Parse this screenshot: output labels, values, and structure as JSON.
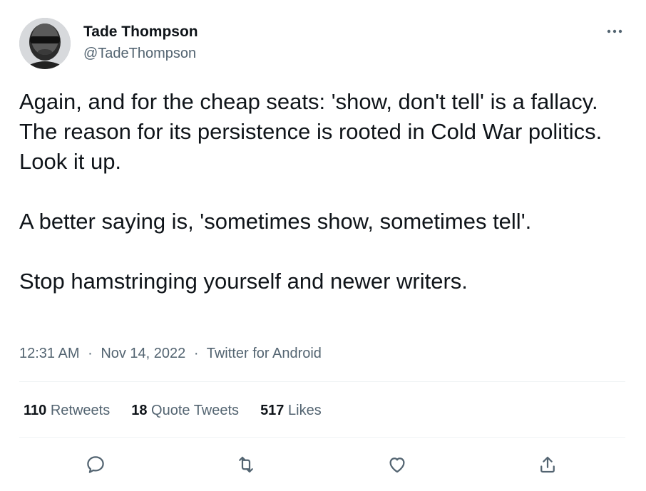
{
  "author": {
    "name": "Tade Thompson",
    "handle": "@TadeThompson"
  },
  "tweet": {
    "paragraphs": [
      "Again, and for the cheap seats: 'show, don't tell' is a fallacy.\nThe reason for its persistence is rooted in Cold War politics. Look it up.",
      "A better saying is, 'sometimes show, sometimes tell'.",
      "Stop hamstringing yourself and newer writers."
    ],
    "time": "12:31 AM",
    "date": "Nov 14, 2022",
    "source": "Twitter for Android",
    "separator": "·"
  },
  "stats": {
    "retweets": {
      "count": "110",
      "label": "Retweets"
    },
    "quotes": {
      "count": "18",
      "label": "Quote Tweets"
    },
    "likes": {
      "count": "517",
      "label": "Likes"
    }
  },
  "icons": {
    "more": "more-horizontal-icon",
    "reply": "reply-icon",
    "retweet": "retweet-icon",
    "like": "heart-icon",
    "share": "share-icon"
  },
  "colors": {
    "text_primary": "#0f1419",
    "text_secondary": "#536471",
    "divider": "#eff3f4",
    "icon": "#536471"
  }
}
